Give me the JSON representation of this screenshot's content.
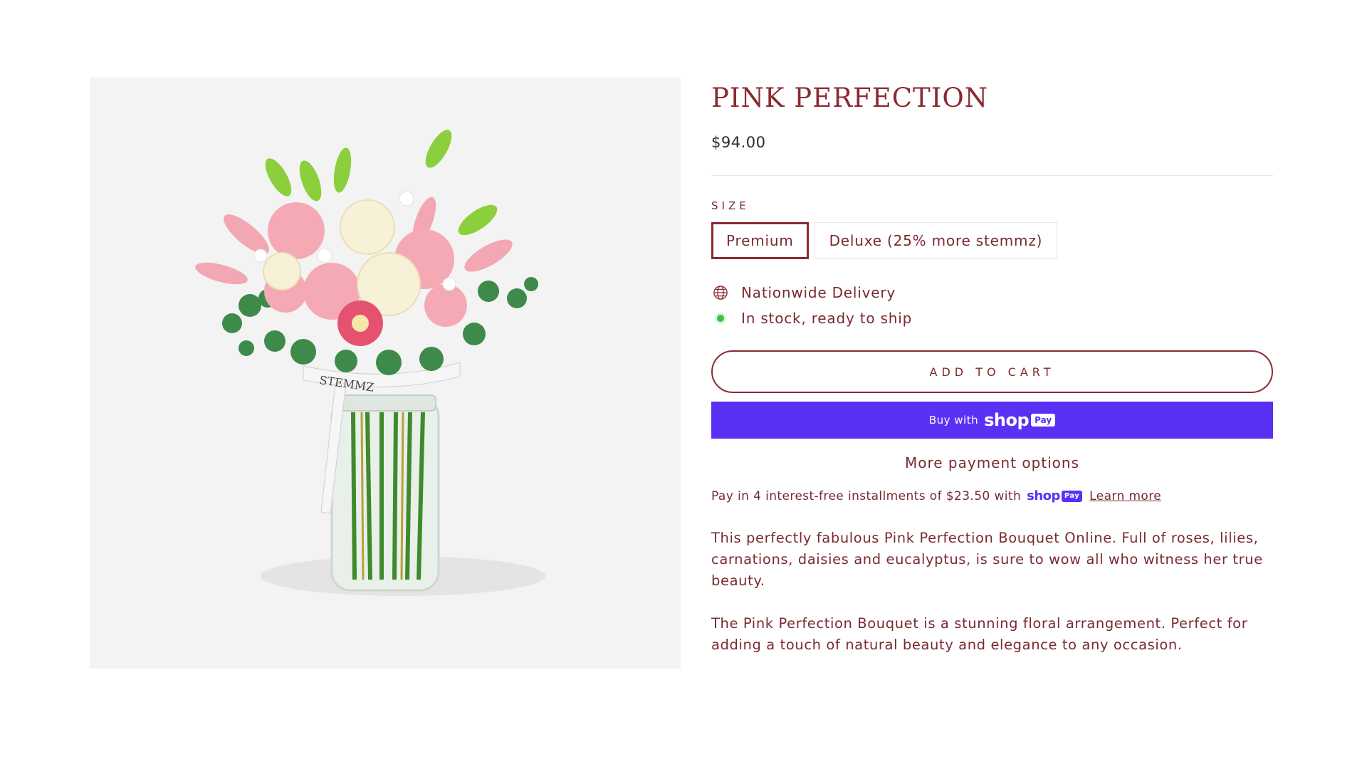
{
  "product": {
    "title": "PINK PERFECTION",
    "price": "$94.00",
    "image_alt": "Pink Perfection bouquet in glass jar",
    "vase_ribbon_text": "STEMMZ"
  },
  "size": {
    "label": "SIZE",
    "options": [
      {
        "label": "Premium",
        "selected": true
      },
      {
        "label": "Deluxe (25% more stemmz)",
        "selected": false
      }
    ]
  },
  "meta": {
    "delivery": "Nationwide Delivery",
    "delivery_icon": "globe-icon",
    "stock": "In stock, ready to ship",
    "stock_icon": "in-stock-dot-icon"
  },
  "actions": {
    "add_to_cart": "ADD TO CART",
    "shop_pay_prefix": "Buy with",
    "shop_pay_brand": "shop",
    "shop_pay_badge": "Pay",
    "more_payment": "More payment options"
  },
  "installments": {
    "text": "Pay in 4 interest-free installments of $23.50 with",
    "brand": "shop",
    "badge": "Pay",
    "learn_more": "Learn more"
  },
  "description": [
    "This perfectly fabulous Pink Perfection Bouquet Online. Full of roses, lilies, carnations, daisies and eucalyptus, is sure to wow all who witness her true beauty.",
    "The Pink Perfection Bouquet is a stunning floral arrangement. Perfect for adding a touch of natural beauty and elegance to any occasion."
  ],
  "colors": {
    "brand": "#8a2a32",
    "text": "#7a2a30",
    "shop_pay": "#5a31f4",
    "stock_green": "#3cc04a"
  }
}
